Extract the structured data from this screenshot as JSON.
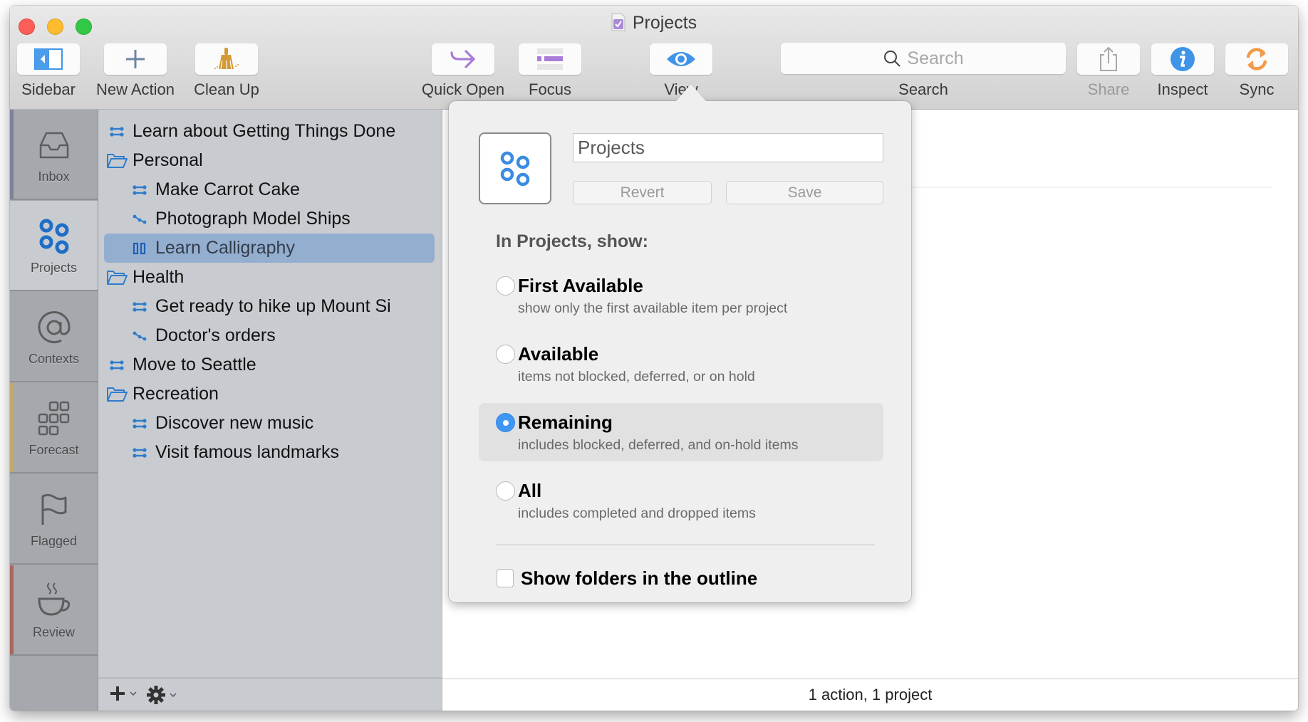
{
  "window": {
    "title": "Projects",
    "traffic_lights": [
      "close",
      "minimize",
      "zoom"
    ]
  },
  "toolbar": {
    "items": [
      {
        "id": "sidebar",
        "label": "Sidebar",
        "icon": "sidebar-toggle-icon"
      },
      {
        "id": "new_action",
        "label": "New Action",
        "icon": "plus-icon"
      },
      {
        "id": "clean_up",
        "label": "Clean Up",
        "icon": "broom-icon"
      },
      {
        "id": "quick_open",
        "label": "Quick Open",
        "icon": "arrow-icon"
      },
      {
        "id": "focus",
        "label": "Focus",
        "icon": "focus-list-icon"
      },
      {
        "id": "view",
        "label": "View",
        "icon": "eye-icon"
      },
      {
        "id": "search",
        "label": "Search",
        "icon": "search-icon"
      },
      {
        "id": "share",
        "label": "Share",
        "icon": "share-icon",
        "disabled": true
      },
      {
        "id": "inspect",
        "label": "Inspect",
        "icon": "info-icon"
      },
      {
        "id": "sync",
        "label": "Sync",
        "icon": "sync-icon"
      }
    ],
    "search_placeholder": "Search"
  },
  "perspectives": [
    {
      "label": "Inbox",
      "icon": "inbox-icon",
      "stripe": "#7a8399"
    },
    {
      "label": "Projects",
      "icon": "projects-icon",
      "active": true
    },
    {
      "label": "Contexts",
      "icon": "at-icon"
    },
    {
      "label": "Forecast",
      "icon": "forecast-icon",
      "stripe": "#c4a869"
    },
    {
      "label": "Flagged",
      "icon": "flag-icon"
    },
    {
      "label": "Review",
      "icon": "coffee-cup-icon",
      "stripe": "#a8685f"
    }
  ],
  "outline": {
    "items": [
      {
        "label": "Learn about Getting Things Done",
        "type": "parallel",
        "level": 0
      },
      {
        "label": "Personal",
        "type": "folder",
        "level": 0
      },
      {
        "label": "Make Carrot Cake",
        "type": "parallel",
        "level": 1
      },
      {
        "label": "Photograph Model Ships",
        "type": "sequential",
        "level": 1
      },
      {
        "label": "Learn Calligraphy",
        "type": "on-hold",
        "level": 1,
        "selected": true
      },
      {
        "label": "Health",
        "type": "folder",
        "level": 0
      },
      {
        "label": "Get ready to hike up Mount Si",
        "type": "parallel",
        "level": 1
      },
      {
        "label": "Doctor's orders",
        "type": "sequential",
        "level": 1
      },
      {
        "label": "Move to Seattle",
        "type": "parallel",
        "level": 0
      },
      {
        "label": "Recreation",
        "type": "folder",
        "level": 0
      },
      {
        "label": "Discover new music",
        "type": "parallel",
        "level": 1
      },
      {
        "label": "Visit famous landmarks",
        "type": "parallel",
        "level": 1
      }
    ]
  },
  "status_bar": {
    "text": "1 action, 1 project"
  },
  "view_popover": {
    "name_value": "Projects",
    "revert_label": "Revert",
    "save_label": "Save",
    "heading": "In Projects, show:",
    "options": [
      {
        "title": "First Available",
        "desc": "show only the first available item per project",
        "selected": false
      },
      {
        "title": "Available",
        "desc": "items not blocked, deferred, or on hold",
        "selected": false
      },
      {
        "title": "Remaining",
        "desc": "includes blocked, deferred, and on-hold items",
        "selected": true
      },
      {
        "title": "All",
        "desc": "includes completed and dropped items",
        "selected": false
      }
    ],
    "show_folders_label": "Show folders in the outline",
    "show_folders_checked": false
  },
  "colors": {
    "accent_blue": "#3e97f5",
    "project_icon_blue": "#2f7ccc",
    "selection": "#94aed0"
  }
}
